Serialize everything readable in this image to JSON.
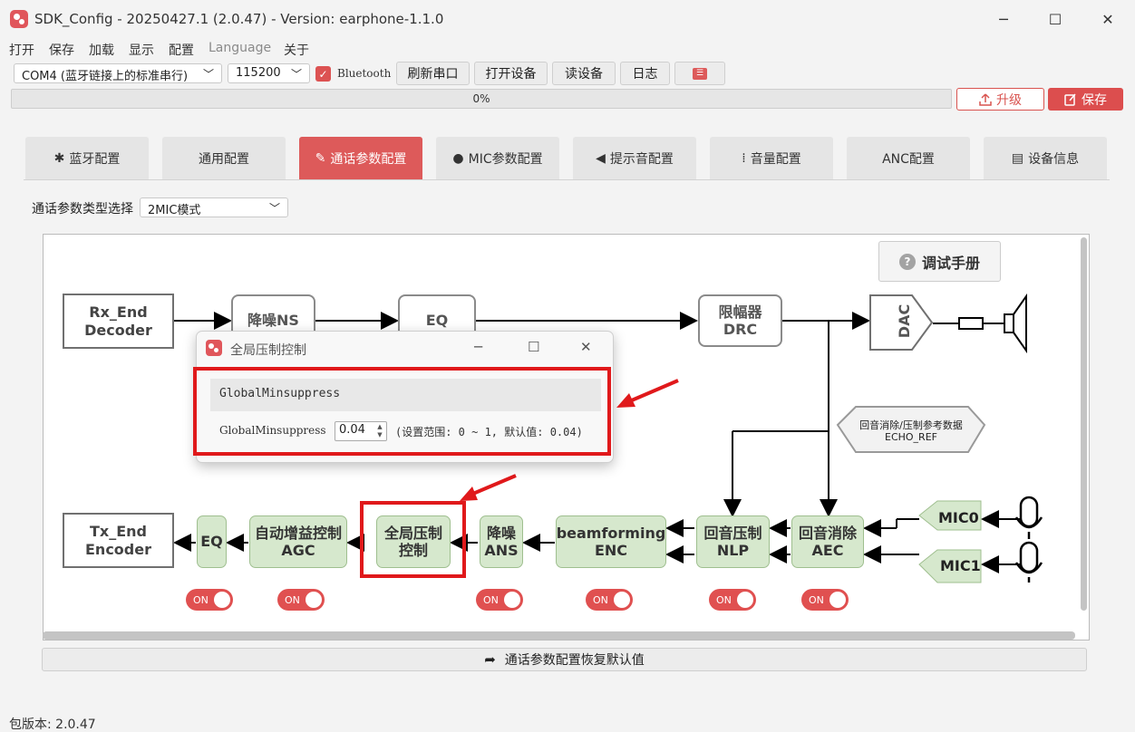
{
  "window": {
    "title": "SDK_Config -  20250427.1  (2.0.47) - Version: earphone-1.1.0",
    "minimize": "─",
    "maximize": "☐",
    "close": "✕"
  },
  "menu": [
    "打开",
    "保存",
    "加载",
    "显示",
    "配置",
    "Language",
    "关于"
  ],
  "toolbar": {
    "port": "COM4 (蓝牙链接上的标准串行)",
    "baud": "115200",
    "bluetooth_label": "Bluetooth",
    "bluetooth_checked": true,
    "refresh": "刷新串口",
    "open_device": "打开设备",
    "read_device": "读设备",
    "log": "日志"
  },
  "progress": {
    "text": "0%",
    "value": 0
  },
  "actions": {
    "upgrade": "升级",
    "save": "保存"
  },
  "tabs": [
    "蓝牙配置",
    "通用配置",
    "通话参数配置",
    "MIC参数配置",
    "提示音配置",
    "音量配置",
    "ANC配置",
    "设备信息"
  ],
  "active_tab": 2,
  "call_type": {
    "label": "通话参数类型选择",
    "value": "2MIC模式"
  },
  "manual_button": "调试手册",
  "diagram": {
    "rx_end": [
      "Rx_End",
      "Decoder"
    ],
    "ns": "降噪NS",
    "eq_top": "EQ",
    "drc": [
      "限幅器",
      "DRC"
    ],
    "dac": "DAC",
    "echo_ref": [
      "回音消除/压制参考数据",
      "ECHO_REF"
    ],
    "tx_end": [
      "Tx_End",
      "Encoder"
    ],
    "eq": "EQ",
    "agc": [
      "自动增益控制",
      "AGC"
    ],
    "global_min": [
      "全局压制",
      "控制"
    ],
    "ans": [
      "降噪",
      "ANS"
    ],
    "enc": [
      "beamforming",
      "ENC"
    ],
    "nlp": [
      "回音压制",
      "NLP"
    ],
    "aec": [
      "回音消除",
      "AEC"
    ],
    "mic0": "MIC0",
    "mic1": "MIC1",
    "toggle_label": "ON",
    "toggles": {
      "agc_enc": true,
      "agc": true,
      "ans": true,
      "enc": true,
      "nlp": true,
      "aec": true
    }
  },
  "restore_button": "通话参数配置恢复默认值",
  "footer": {
    "version": "包版本: 2.0.47"
  },
  "dialog": {
    "title": "全局压制控制",
    "group_title": "GlobalMinsuppress",
    "field_label": "GlobalMinsuppress",
    "value": "0.04",
    "range": "(设置范围: 0 ~ 1, 默认值: 0.04)"
  },
  "colors": {
    "accent": "#dd5a5a",
    "highlight": "#e0191b",
    "block_green": "#d6e8cd"
  }
}
